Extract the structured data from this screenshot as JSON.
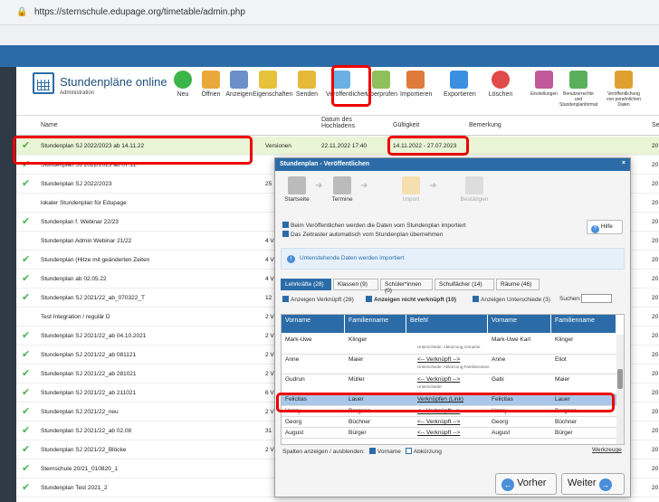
{
  "browser": {
    "url": "https://sternschule.edupage.org/timetable/admin.php"
  },
  "app": {
    "title": "Stundenpläne online",
    "subtitle": "Administration"
  },
  "toolbar": [
    {
      "label": "Neu",
      "icon": "plus-icon",
      "color": "#3bb54a"
    },
    {
      "label": "Öffnen",
      "icon": "folder-icon",
      "color": "#e8a93a"
    },
    {
      "label": "Anzeigen",
      "icon": "grid-icon",
      "color": "#6a8fc9"
    },
    {
      "label": "Eigenschaften",
      "icon": "pencil-icon",
      "color": "#e6c13a"
    },
    {
      "label": "Senden",
      "icon": "envelope-icon",
      "color": "#e6b93a"
    },
    {
      "label": "Veröffentlichen",
      "icon": "cloud-icon",
      "color": "#6ab0e6"
    },
    {
      "label": "Überprüfen",
      "icon": "checklist-icon",
      "color": "#8fbf5a"
    },
    {
      "label": "Importieren",
      "icon": "import-icon",
      "color": "#e07a3a"
    },
    {
      "label": "Exportieren",
      "icon": "export-icon",
      "color": "#3a8fe0"
    },
    {
      "label": "Löschen",
      "icon": "delete-icon",
      "color": "#e04a4a"
    },
    {
      "label": "Einstellungen",
      "icon": "tools-icon",
      "color": "#c05a9a"
    },
    {
      "label": "Benutzerrechte und Stundenplanformat",
      "icon": "shield-icon",
      "color": "#5ab05a"
    },
    {
      "label": "Veröffentlichung von persönlichen Daten",
      "icon": "key-icon",
      "color": "#e0a030"
    }
  ],
  "table": {
    "headers": {
      "name": "Name",
      "datum": "Datum des Hochladens",
      "gueltig": "Gültigkeit",
      "bemerkung": "Bemerkung",
      "s": "Se"
    },
    "rows": [
      {
        "name": "Stundenplan SJ 2022/2023 ab 14.11.22",
        "checked": true,
        "c2": "Versionen",
        "datum": "22.11.2022 17:40",
        "gueltig": "14.11.2022 - 27.07.2023",
        "c3": "20"
      },
      {
        "name": "Stundenplan SJ 2022/2023 ab 07.11.",
        "checked": true,
        "c2": "",
        "c3": "20"
      },
      {
        "name": "Stundenplan SJ 2022/2023",
        "checked": true,
        "c2": "25",
        "c3": "20"
      },
      {
        "name": "lokaler Stundenplan für Edupage",
        "checked": false,
        "c2": "",
        "c3": "20"
      },
      {
        "name": "Stundenplan f. Webinar 22/23",
        "checked": true,
        "c2": "",
        "c3": "20"
      },
      {
        "name": "Stundenplan Admin Webinar 21/22",
        "checked": false,
        "c2": "4 V",
        "c3": "20"
      },
      {
        "name": "Stundenplan (Hitze mit geänderten Zeiten",
        "checked": true,
        "c2": "4 V",
        "c3": "20"
      },
      {
        "name": "Stundenplan ab 02.05.22",
        "checked": true,
        "c2": "4 V",
        "c3": "20"
      },
      {
        "name": "Stundenplan SJ 2021/22_ab_070322_T",
        "checked": true,
        "c2": "12",
        "c3": "20"
      },
      {
        "name": "Test Integration / regulär D",
        "checked": false,
        "c2": "2 V",
        "c3": "20"
      },
      {
        "name": "Stundenplan SJ 2021/22_ab 04.10.2021",
        "checked": true,
        "c2": "2 V",
        "c3": "20"
      },
      {
        "name": "Stundenplan SJ 2021/22_ab 081121",
        "checked": true,
        "c2": "2 V",
        "c3": "20"
      },
      {
        "name": "Stundenplan SJ 2021/22_ab 281021",
        "checked": true,
        "c2": "2 V",
        "c3": "20"
      },
      {
        "name": "Stundenplan SJ 2021/22_ab 211021",
        "checked": true,
        "c2": "6 V",
        "c3": "20"
      },
      {
        "name": "Stundenplan SJ 2021/22_neu",
        "checked": true,
        "c2": "2 V",
        "c3": "20"
      },
      {
        "name": "Stundenplan SJ 2021/22_ab 02.08",
        "checked": true,
        "c2": "31",
        "c3": "20"
      },
      {
        "name": "Stundenplan SJ 2021/22_Blöcke",
        "checked": true,
        "c2": "2 V",
        "c3": "20"
      },
      {
        "name": "Sternschule 20/21_010820_1",
        "checked": true,
        "c2": "",
        "c3": "20"
      },
      {
        "name": "Stundenplan Test 2021_2",
        "checked": true,
        "c2": "",
        "c3": "20"
      }
    ]
  },
  "dialog": {
    "title": "Stundenplan - Veröffentlichen",
    "close": "×",
    "steps": [
      {
        "label": "Startseite"
      },
      {
        "label": "Termine"
      },
      {
        "label": "Import"
      },
      {
        "label": "Bestätigen"
      }
    ],
    "opt1": "Beim Veröffentlichen werden die Daten vom Stundenplan importiert",
    "opt2": "Das Zeitraster automatisch vom Stundenplan übernehmen",
    "hilfe": "Hilfe",
    "info": "Untenstehende Daten werden importiert",
    "tabs": [
      "Lehrkräfte (28)",
      "Klassen (9)",
      "Schüler*innen (0)",
      "Schulfächer (14)",
      "Räume (46)"
    ],
    "filters": {
      "f1": "Anzeigen Verknüpft (28)",
      "f2": "Anzeigen nicht verknüpft (10)",
      "f3": "Anzeigen Unterschiede (3)",
      "search": "Suchen:"
    },
    "cols": [
      "Vorname",
      "Familienname",
      "Befehl",
      "Vorname",
      "Familienname"
    ],
    "rows": [
      {
        "v": "Mark-Uwe",
        "f": "Klinger",
        "b": "",
        "note": "Unterschiede: Abkürzung,Vorname",
        "v2": "Mark-Uwe Karl",
        "f2": "Klinger"
      },
      {
        "v": "Anne",
        "f": "Maier",
        "b": "<-- Verknüpft -->",
        "note": "Unterschiede: Abkürzung,Familienname",
        "v2": "Anne",
        "f2": "Eliot"
      },
      {
        "v": "Gudrun",
        "f": "Müller",
        "b": "<-- Verknüpft -->",
        "note": "Unterschiede:",
        "v2": "Gabi",
        "f2": "Maier"
      },
      {
        "v": "Felicitas",
        "f": "Lauer",
        "b": "Verknüpfen (Link)",
        "note": "",
        "v2": "Felicitas",
        "f2": "Lauer"
      },
      {
        "v": "Henry",
        "f": "Bergson",
        "b": "<-- Verknüpft -->",
        "note": "",
        "v2": "Henry",
        "f2": "Bergson"
      },
      {
        "v": "Georg",
        "f": "Büchner",
        "b": "<-- Verknüpft -->",
        "note": "",
        "v2": "Georg",
        "f2": "Büchner"
      },
      {
        "v": "August",
        "f": "Bürger",
        "b": "<-- Verknüpft -->",
        "note": "",
        "v2": "August",
        "f2": "Bürger"
      }
    ],
    "colsToggle": "Spalten anzeigen / ausblenden:",
    "toggleVorname": "Vorname",
    "toggleAbk": "Abkürzung",
    "werkzeuge": "Werkzeuge",
    "prev": "Vorher",
    "next": "Weiter"
  }
}
